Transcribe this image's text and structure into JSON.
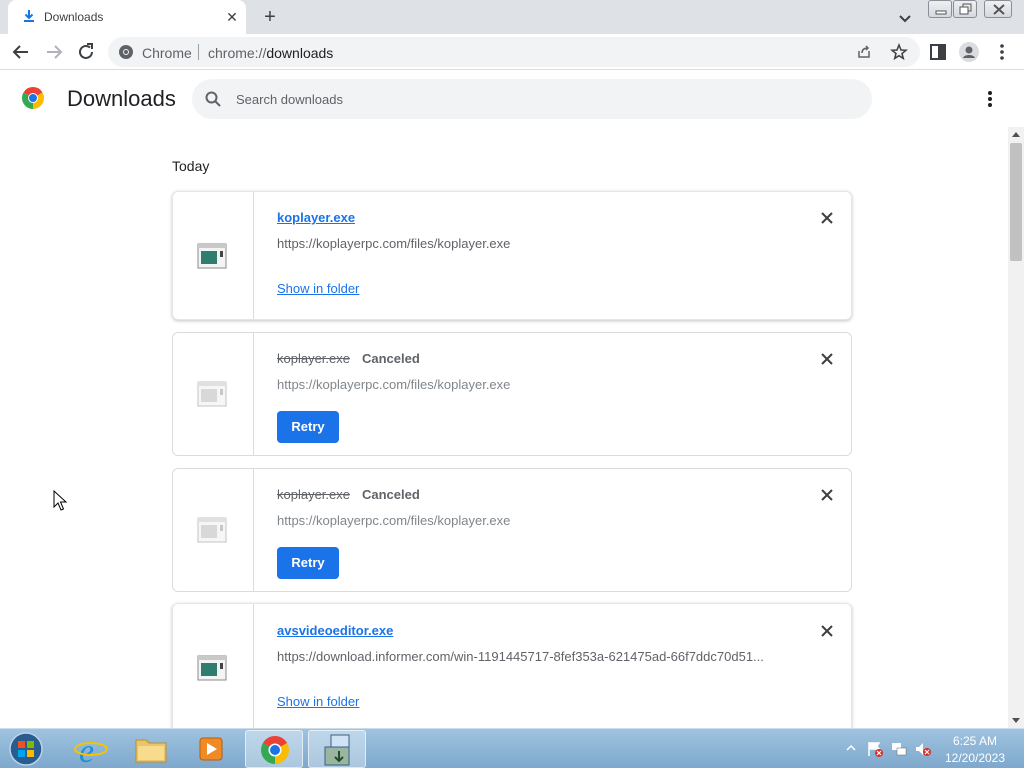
{
  "tab": {
    "title": "Downloads",
    "close_glyph": "✕",
    "new_tab_glyph": "+"
  },
  "omnibox": {
    "site_label": "Chrome",
    "url_host": "chrome://",
    "url_path": "downloads"
  },
  "page": {
    "title": "Downloads",
    "search_placeholder": "Search downloads",
    "date_header": "Today"
  },
  "downloads": [
    {
      "filename": "koplayer.exe",
      "state": "complete",
      "status": "",
      "url": "https://koplayerpc.com/files/koplayer.exe",
      "action_label": "Show in folder"
    },
    {
      "filename": "koplayer.exe",
      "state": "canceled",
      "status": "Canceled",
      "url": "https://koplayerpc.com/files/koplayer.exe",
      "action_label": "Retry"
    },
    {
      "filename": "koplayer.exe",
      "state": "canceled",
      "status": "Canceled",
      "url": "https://koplayerpc.com/files/koplayer.exe",
      "action_label": "Retry"
    },
    {
      "filename": "avsvideoeditor.exe",
      "state": "complete",
      "status": "",
      "url": "https://download.informer.com/win-1191445717-8fef353a-621475ad-66f7ddc70d51...",
      "action_label": "Show in folder"
    }
  ],
  "taskbar": {
    "time": "6:25 AM",
    "date": "12/20/2023",
    "apps": [
      "start-orb",
      "internet-explorer",
      "file-explorer",
      "media-player",
      "chrome",
      "installer"
    ]
  },
  "colors": {
    "accent": "#1a73e8",
    "tabstrip": "#dee1e6",
    "omnibox_bg": "#f1f3f4",
    "taskbar": "#8fb6d8"
  }
}
